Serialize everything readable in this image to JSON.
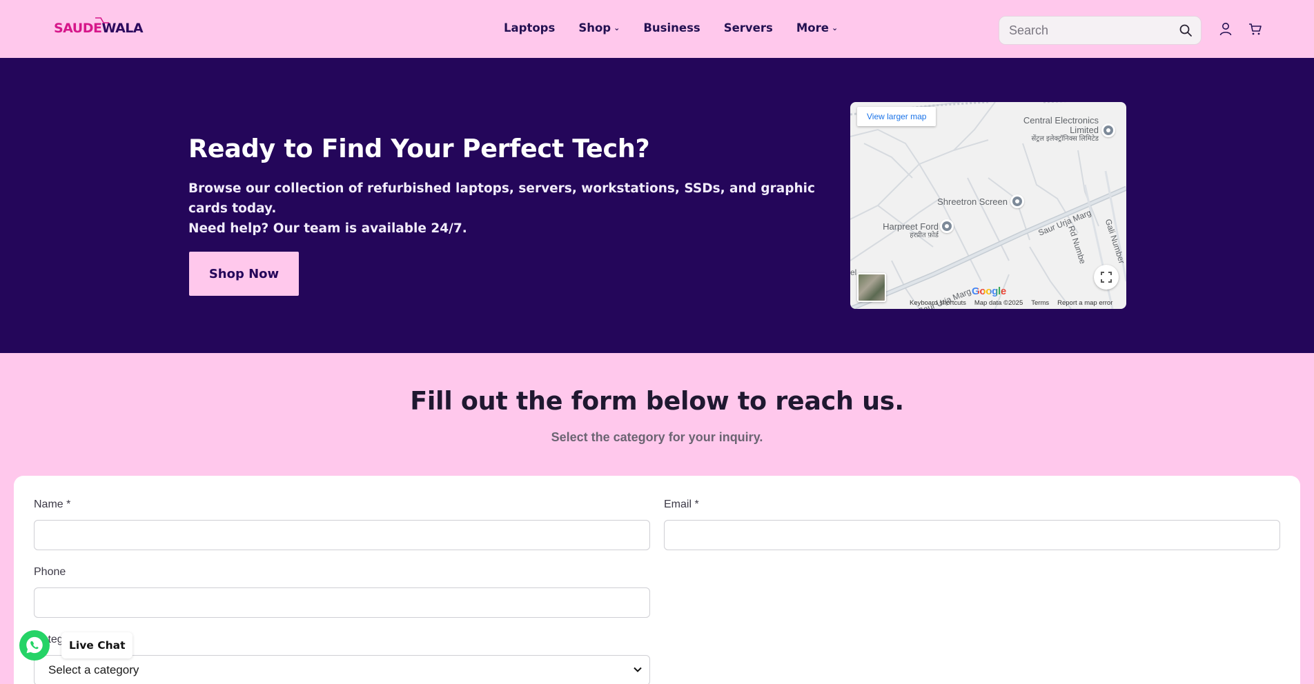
{
  "header": {
    "logo": {
      "part1": "SAUDE",
      "part2": "WALA"
    },
    "nav": [
      {
        "label": "Laptops",
        "dropdown": false
      },
      {
        "label": "Shop",
        "dropdown": true
      },
      {
        "label": "Business",
        "dropdown": false
      },
      {
        "label": "Servers",
        "dropdown": false
      },
      {
        "label": "More",
        "dropdown": true
      }
    ],
    "search": {
      "placeholder": "Search",
      "value": ""
    },
    "icons": [
      "search-icon",
      "user-icon",
      "cart-icon"
    ]
  },
  "hero": {
    "title": "Ready to Find Your Perfect Tech?",
    "description_line1": "Browse our collection of refurbished laptops, servers, workstations, SSDs, and graphic cards today.",
    "description_line2": "Need help? Our team is available 24/7.",
    "cta": "Shop Now"
  },
  "map": {
    "view_larger": "View larger map",
    "places": {
      "central_electronics": {
        "name": "Central Electronics Limited",
        "local": "सेंट्रल इलेक्ट्रॉनिक्स लिमिटेड"
      },
      "shreetron": {
        "name": "Shreetron Screen"
      },
      "harpreet": {
        "name": "Harpreet Ford",
        "local": "हरप्रीत फ़ोर्ड"
      }
    },
    "roads": {
      "main": "Saur Urja Marg",
      "main_lower": "Saur Urja Marg",
      "rd": "Rd Numbe",
      "gali": "Gali Number"
    },
    "edge_label": "el",
    "brand": "Google",
    "attribution": [
      "Keyboard shortcuts",
      "Map data ©2025",
      "Terms",
      "Report a map error"
    ]
  },
  "form": {
    "heading": "Fill out the form below to reach us.",
    "subheading": "Select the category for your inquiry.",
    "fields": {
      "name": {
        "label": "Name *",
        "value": ""
      },
      "email": {
        "label": "Email *",
        "value": ""
      },
      "phone": {
        "label": "Phone",
        "value": ""
      },
      "category": {
        "label": "Category *",
        "selected": "Select a category"
      }
    }
  },
  "live_chat": {
    "label": "Live Chat"
  },
  "colors": {
    "pink_bg": "#ffc8ec",
    "hero_bg": "#24065a",
    "logo_pink": "#d6178a",
    "whatsapp": "#25d366"
  }
}
